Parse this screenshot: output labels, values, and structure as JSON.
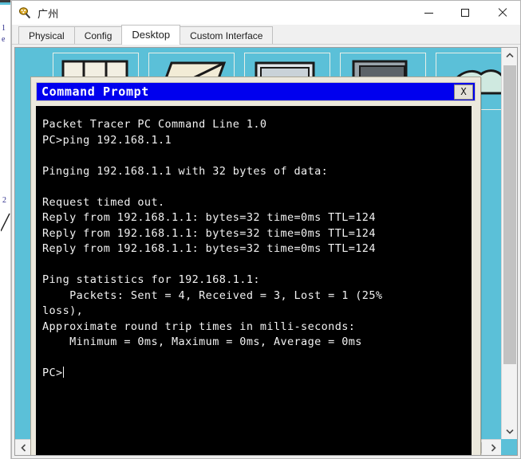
{
  "backdrop": {
    "fragment_lines": [
      "1",
      "e",
      "2"
    ]
  },
  "window": {
    "title": "广州",
    "app_icon": "packet-tracer-device-icon",
    "controls": {
      "minimize": "minimize-icon",
      "maximize": "maximize-icon",
      "close": "close-icon"
    }
  },
  "tabs": [
    {
      "label": "Physical",
      "active": false
    },
    {
      "label": "Config",
      "active": false
    },
    {
      "label": "Desktop",
      "active": true
    },
    {
      "label": "Custom Interface",
      "active": false
    }
  ],
  "desktop": {
    "background_color": "#5bc0d8",
    "icons": [
      {
        "name": "ip-configuration-icon"
      },
      {
        "name": "dial-up-icon"
      },
      {
        "name": "terminal-icon"
      },
      {
        "name": "command-prompt-icon"
      },
      {
        "name": "web-browser-icon"
      }
    ]
  },
  "cmd_window": {
    "title": "Command Prompt",
    "title_bar_color": "#0000ee",
    "close_button_label": "X",
    "console_bg": "#000000",
    "console_fg": "#f2f2f2",
    "lines": [
      "Packet Tracer PC Command Line 1.0",
      "PC>ping 192.168.1.1",
      "",
      "Pinging 192.168.1.1 with 32 bytes of data:",
      "",
      "Request timed out.",
      "Reply from 192.168.1.1: bytes=32 time=0ms TTL=124",
      "Reply from 192.168.1.1: bytes=32 time=0ms TTL=124",
      "Reply from 192.168.1.1: bytes=32 time=0ms TTL=124",
      "",
      "Ping statistics for 192.168.1.1:",
      "    Packets: Sent = 4, Received = 3, Lost = 1 (25%",
      "loss),",
      "Approximate round trip times in milli-seconds:",
      "    Minimum = 0ms, Maximum = 0ms, Average = 0ms",
      ""
    ],
    "prompt": "PC>"
  },
  "scrollbars": {
    "vertical": {
      "up_arrow": "chevron-up-icon",
      "down_arrow": "chevron-down-icon"
    },
    "horizontal": {
      "left_arrow": "chevron-left-icon",
      "right_arrow": "chevron-right-icon"
    }
  }
}
